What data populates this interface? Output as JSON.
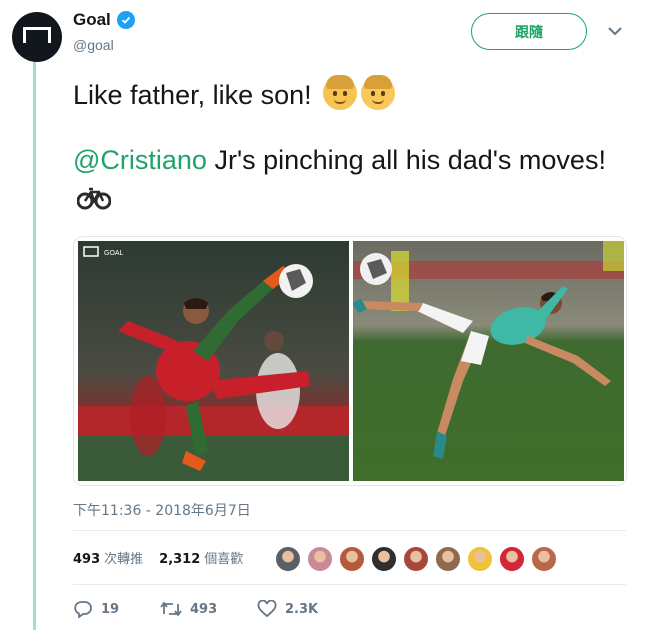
{
  "account": {
    "name": "Goal",
    "handle": "@goal",
    "verified": true
  },
  "follow_button": "跟隨",
  "tweet": {
    "line1": "Like father, like son!",
    "mention": "@Cristiano",
    "line2_rest": " Jr's pinching all his dad's moves!",
    "emojis": [
      "man-emoji",
      "boy-emoji",
      "bicycle-emoji"
    ]
  },
  "media": {
    "left_logo_text": "GOAL"
  },
  "timestamp": "下午11:36 - 2018年6月7日",
  "stats": {
    "retweets_count": "493",
    "retweets_label": "次轉推",
    "likes_count": "2,312",
    "likes_label": "個喜歡"
  },
  "liker_colors": [
    "#5a5f66",
    "#c98a95",
    "#b55a3a",
    "#2f2f2f",
    "#a8473e",
    "#8e6a50",
    "#f0c13a",
    "#d2253a",
    "#b9694a"
  ],
  "actions": {
    "reply_count": "19",
    "retweet_count": "493",
    "like_count": "2.3K"
  },
  "colors": {
    "accent": "#1fa36a",
    "verified": "#1da1f2",
    "thread": "#a8dcc8"
  }
}
